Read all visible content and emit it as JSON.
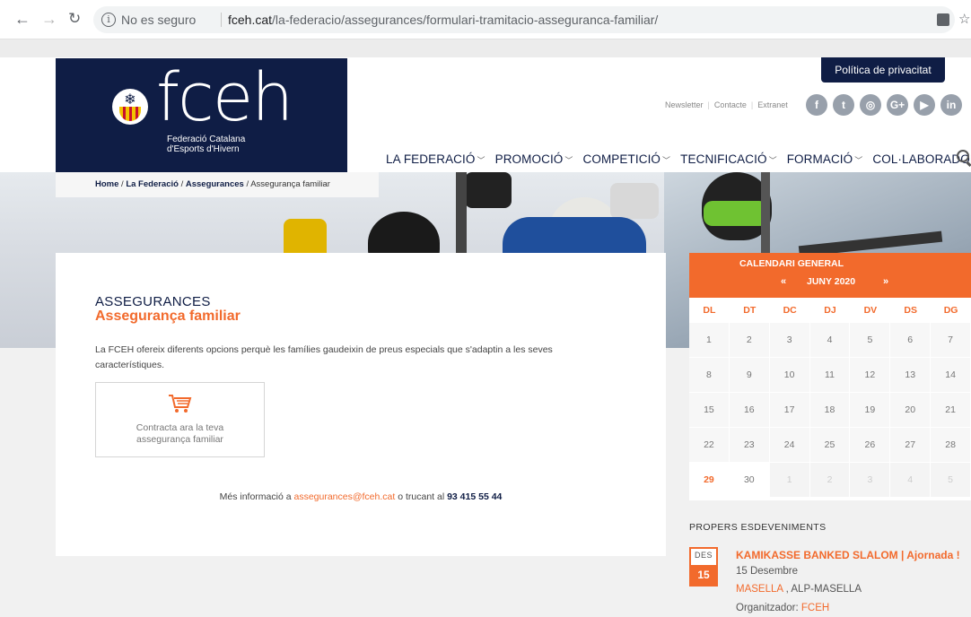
{
  "browser": {
    "security_label": "No es seguro",
    "url_host": "fceh.cat",
    "url_path": "/la-federacio/assegurances/formulari-tramitacio-asseguranca-familiar/"
  },
  "header": {
    "logo_text": "fceh",
    "logo_sub1": "Federació Catalana",
    "logo_sub2": "d'Esports d'Hivern",
    "privacy_tab": "Política de privacitat",
    "top_links": [
      "Newsletter",
      "Contacte",
      "Extranet"
    ],
    "socials": [
      "f",
      "t",
      "◎",
      "G+",
      "▶",
      "in"
    ],
    "nav": [
      "LA FEDERACIÓ",
      "PROMOCIÓ",
      "COMPETICIÓ",
      "TECNIFICACIÓ",
      "FORMACIÓ",
      "COL·LABORADORS"
    ]
  },
  "breadcrumb": {
    "home": "Home",
    "sep": " / ",
    "federacio": "La Federació",
    "assegurances": "Assegurances",
    "current": "Assegurança familiar"
  },
  "content": {
    "section": "ASSEGURANCES",
    "title": "Assegurança familiar",
    "intro": "La FCEH ofereix diferents opcions perquè les famílies gaudeixin de preus especials que s'adaptin a les seves característiques.",
    "cta_label": "Contracta ara la teva assegurança familiar",
    "more_prefix": "Més informació a ",
    "email": "assegurances@fceh.cat",
    "more_mid": " o trucant al ",
    "phone": "93 415 55 44"
  },
  "calendar": {
    "title": "CALENDARI GENERAL",
    "prev": "«",
    "month": "JUNY 2020",
    "next": "»",
    "days_of_week": [
      "DL",
      "DT",
      "DC",
      "DJ",
      "DV",
      "DS",
      "DG"
    ],
    "weeks": [
      [
        "1",
        "2",
        "3",
        "4",
        "5",
        "6",
        "7"
      ],
      [
        "8",
        "9",
        "10",
        "11",
        "12",
        "13",
        "14"
      ],
      [
        "15",
        "16",
        "17",
        "18",
        "19",
        "20",
        "21"
      ],
      [
        "22",
        "23",
        "24",
        "25",
        "26",
        "27",
        "28"
      ],
      [
        "29",
        "30",
        "1",
        "2",
        "3",
        "4",
        "5"
      ]
    ],
    "today": "29"
  },
  "events": {
    "title": "PROPERS ESDEVENIMENTS",
    "items": [
      {
        "month": "DES",
        "day": "15",
        "name": "KAMIKASSE BANKED SLALOM | Ajornada !",
        "date": "15 Desembre",
        "place": "MASELLA",
        "place_rest": " , ALP-MASELLA",
        "organizer_label": "Organitzador: ",
        "organizer": "FCEH"
      }
    ]
  },
  "colors": {
    "navy": "#0f1d45",
    "orange": "#f26a2c"
  }
}
